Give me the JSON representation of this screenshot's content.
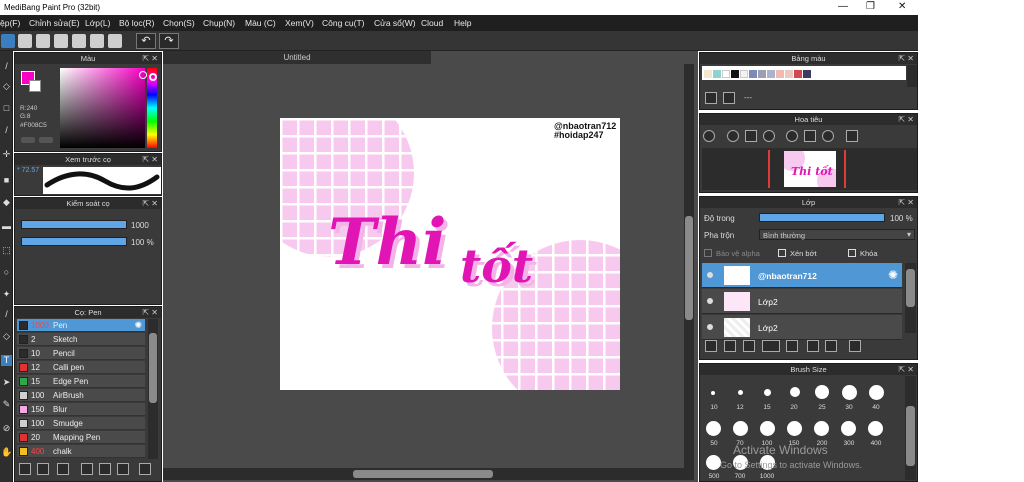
{
  "window": {
    "title": "MediBang Paint Pro (32bit)",
    "controls": [
      "—",
      "❐",
      "✕"
    ]
  },
  "menu": [
    "ệp(F)",
    "Chỉnh sửa(E)",
    "Lớp(L)",
    "Bộ lọc(R)",
    "Chọn(S)",
    "Chụp(N)",
    "Màu (C)",
    "Xem(V)",
    "Công cụ(T)",
    "Cửa sổ(W)",
    "Cloud",
    "Help"
  ],
  "color_panel": {
    "title": "Màu",
    "r": "R:240",
    "g": "G:8",
    "hex": "#F008C5",
    "fg_color": "#f800c5"
  },
  "preview_panel": {
    "title": "Xem trước cọ",
    "size_label": "* 72.57"
  },
  "control_panel": {
    "title": "Kiểm soát cọ",
    "size_value": "1000",
    "opacity_value": "100 %"
  },
  "brush_panel": {
    "title": "Cọ: Pen",
    "brushes": [
      {
        "size": "1000",
        "name": "Pen",
        "color": "#2b2b2b",
        "selected": true
      },
      {
        "size": "2",
        "name": "Sketch",
        "color": "#2b2b2b"
      },
      {
        "size": "10",
        "name": "Pencil",
        "color": "#2b2b2b"
      },
      {
        "size": "12",
        "name": "Calli pen",
        "color": "#d33"
      },
      {
        "size": "15",
        "name": "Edge Pen",
        "color": "#2ea84a"
      },
      {
        "size": "100",
        "name": "AirBrush",
        "color": "#cfcfcf"
      },
      {
        "size": "150",
        "name": "Blur",
        "color": "#f3a9e4"
      },
      {
        "size": "100",
        "name": "Smudge",
        "color": "#cfcfcf"
      },
      {
        "size": "20",
        "name": "Mapping Pen",
        "color": "#d33"
      },
      {
        "size": "400",
        "name": "chalk",
        "color": "#f0c020"
      }
    ]
  },
  "canvas": {
    "tab": "Untitled",
    "tag1": "@nbaotran712",
    "tag2": "#hoidap247",
    "lettering": "Thi tốt"
  },
  "palette_panel": {
    "title": "Bảng màu",
    "swatches": [
      "#f4e6cf",
      "#8fd3d0",
      "#ffffff",
      "#111111",
      "#f2f2f2",
      "#7d8ab7",
      "#9b9fb2",
      "#a9b3c9",
      "#f3b8b0",
      "#e8c9c2",
      "#d4484f",
      "#3a3e63"
    ],
    "dash": "---"
  },
  "navigator_panel": {
    "title": "Hoa tiêu"
  },
  "layer_panel": {
    "title": "Lớp",
    "opacity_label": "Độ trong",
    "opacity_value": "100 %",
    "blend_label": "Pha trộn",
    "blend_value": "Bình thường",
    "protect_alpha": "Bảo vệ alpha",
    "clipping": "Xén bớt",
    "lock": "Khóa",
    "layers": [
      {
        "name": "@nbaotran712",
        "selected": true
      },
      {
        "name": "Lớp2"
      },
      {
        "name": "Lớp2"
      }
    ]
  },
  "brushsize_panel": {
    "title": "Brush Size",
    "sizes": [
      "10",
      "12",
      "15",
      "20",
      "25",
      "30",
      "40",
      "50",
      "70",
      "100",
      "150",
      "200",
      "300",
      "400",
      "500",
      "700",
      "1000"
    ]
  },
  "watermark": {
    "line1": "Activate Windows",
    "line2": "Go to Settings to activate Windows."
  }
}
